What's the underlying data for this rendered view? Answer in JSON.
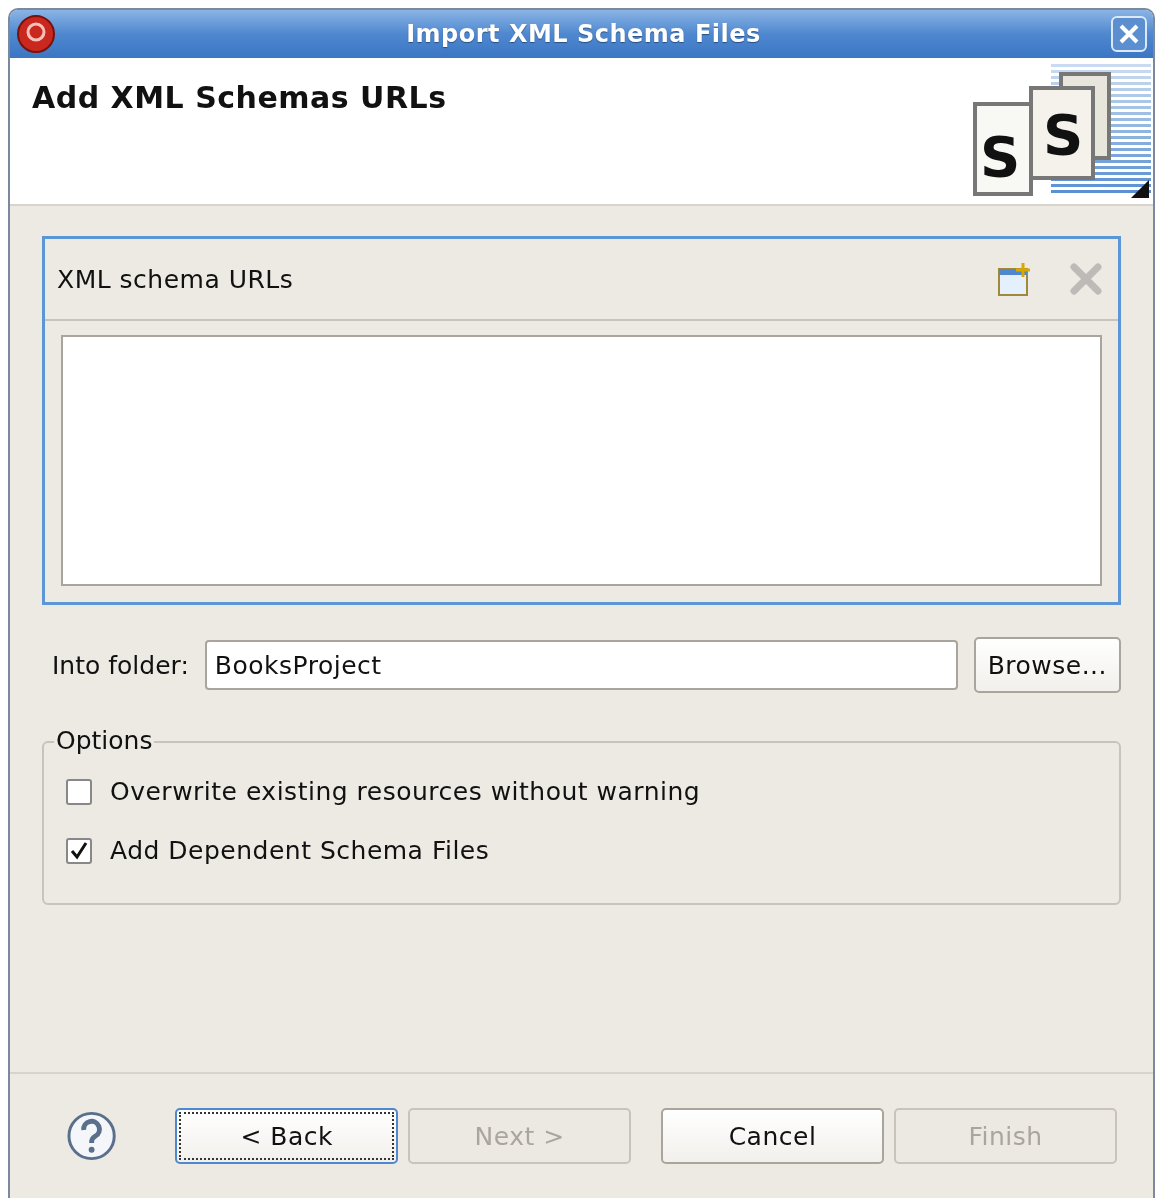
{
  "window": {
    "title": "Import XML Schema Files"
  },
  "header": {
    "title": "Add XML Schemas URLs",
    "logo_letters": [
      "S",
      "S"
    ]
  },
  "urls_section": {
    "title": "XML schema URLs",
    "tools": [
      {
        "kind": "add",
        "disabled": false
      },
      {
        "kind": "remove",
        "disabled": true
      }
    ]
  },
  "folder": {
    "label": "Into folder:",
    "value": "BooksProject",
    "browse": "Browse..."
  },
  "options": {
    "title": "Options",
    "items": [
      {
        "label": "Overwrite existing resources without warning",
        "checked": false
      },
      {
        "label": "Add Dependent Schema Files",
        "checked": true
      }
    ]
  },
  "buttons": [
    {
      "label": "< Back",
      "disabled": false,
      "focused": true
    },
    {
      "label": "Next >",
      "disabled": true,
      "focused": false
    },
    {
      "label": "Cancel",
      "disabled": false,
      "focused": false
    },
    {
      "label": "Finish",
      "disabled": true,
      "focused": false
    }
  ]
}
